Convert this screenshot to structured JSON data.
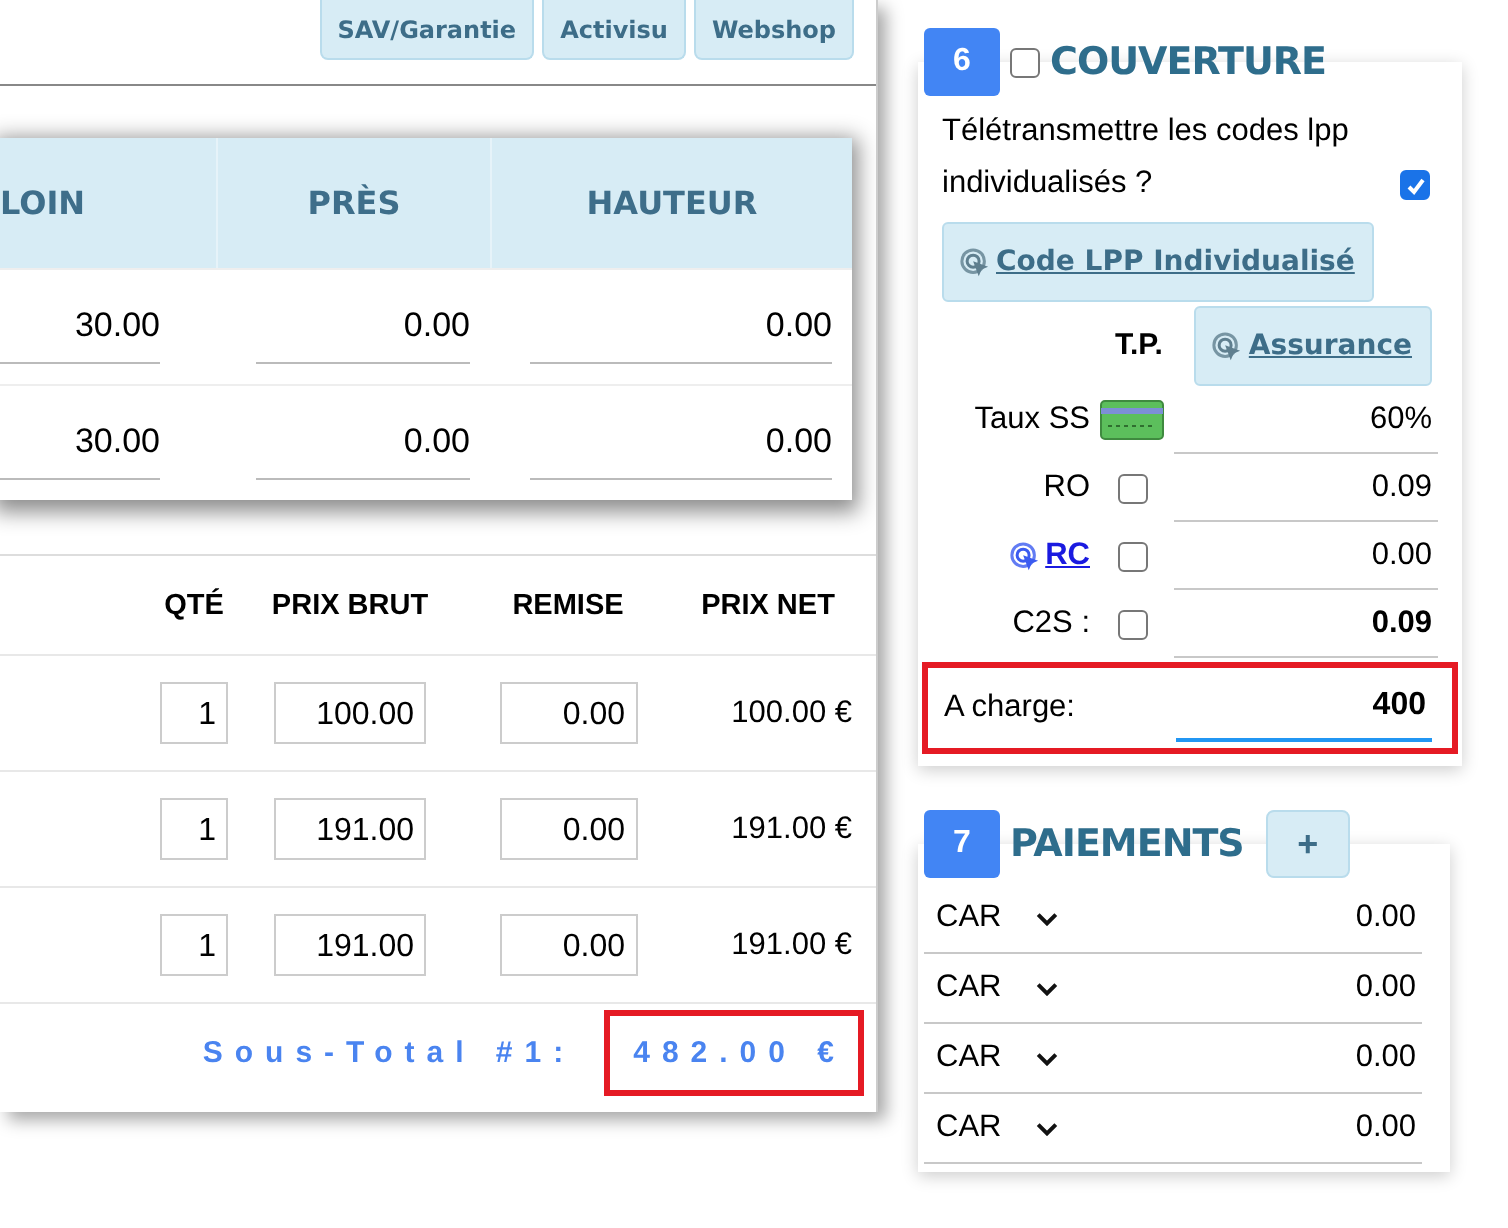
{
  "toolbar": {
    "buttons": [
      "SAV/Garantie",
      "Activisu",
      "Webshop"
    ]
  },
  "measurements": {
    "columns": [
      "LOIN",
      "PRÈS",
      "HAUTEUR"
    ],
    "rows": [
      [
        "30.00",
        "0.00",
        "0.00"
      ],
      [
        "30.00",
        "0.00",
        "0.00"
      ]
    ]
  },
  "lines": {
    "columns": [
      "QTÉ",
      "PRIX BRUT",
      "REMISE",
      "PRIX NET"
    ],
    "rows": [
      {
        "qty": "1",
        "gross": "100.00",
        "discount": "0.00",
        "net": "100.00 €"
      },
      {
        "qty": "1",
        "gross": "191.00",
        "discount": "0.00",
        "net": "191.00 €"
      },
      {
        "qty": "1",
        "gross": "191.00",
        "discount": "0.00",
        "net": "191.00 €"
      }
    ]
  },
  "subtotal": {
    "label": "Sous-Total #1:",
    "value": "482.00 €",
    "highlighted": true
  },
  "coverage": {
    "number": "6",
    "checked": false,
    "title": "COUVERTURE",
    "teletransmit": {
      "label": "Télétransmettre les codes lpp individualisés ?",
      "checked": true
    },
    "lpp_button": "Code LPP Individualisé",
    "tp_label": "T.P.",
    "insurance_button": "Assurance",
    "rows": [
      {
        "kind": "card",
        "label": "Taux SS",
        "value": "60%"
      },
      {
        "kind": "checkbox",
        "label": "RO",
        "checked": false,
        "bold": false,
        "value": "0.09"
      },
      {
        "kind": "link",
        "label": "RC",
        "checked": false,
        "bold": false,
        "value": "0.00"
      },
      {
        "kind": "checkbox",
        "label": "C2S :",
        "checked": false,
        "bold": true,
        "value": "0.09"
      }
    ],
    "charge": {
      "label": "A charge:",
      "value": "400",
      "highlighted": true
    }
  },
  "payments": {
    "number": "7",
    "title": "PAIEMENTS",
    "add_button": "+",
    "rows": [
      {
        "method": "CAR",
        "amount": "0.00"
      },
      {
        "method": "CAR",
        "amount": "0.00"
      },
      {
        "method": "CAR",
        "amount": "0.00"
      },
      {
        "method": "CAR",
        "amount": "0.00"
      }
    ]
  }
}
